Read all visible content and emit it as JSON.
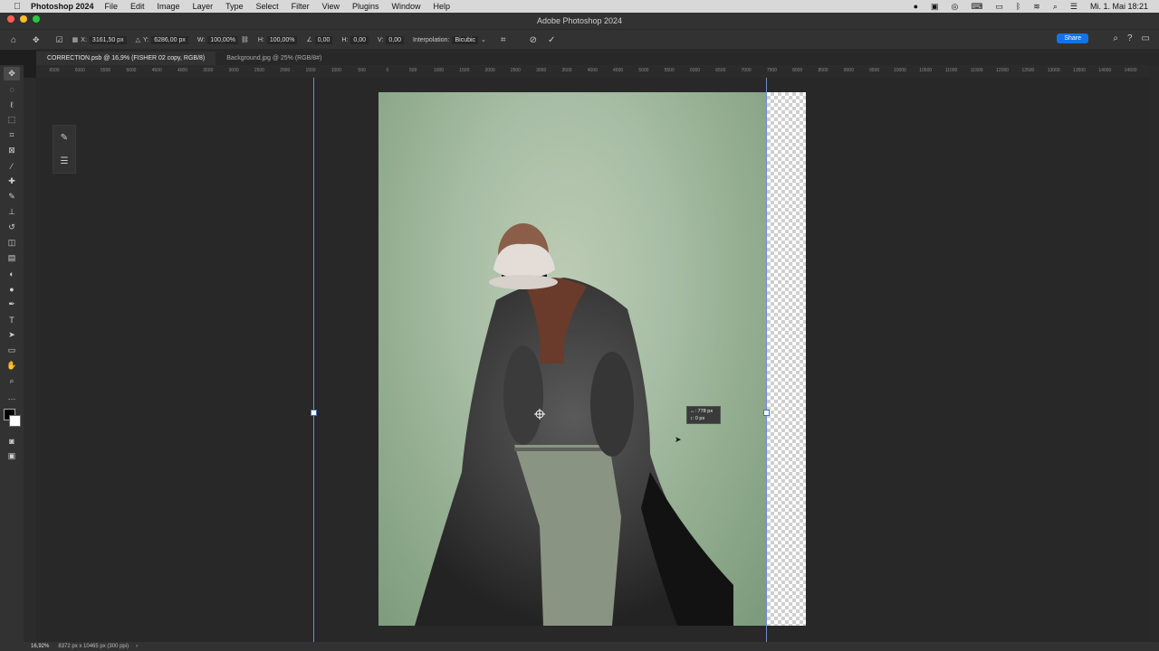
{
  "menubar": {
    "app_name": "Photoshop 2024",
    "items": [
      "File",
      "Edit",
      "Image",
      "Layer",
      "Type",
      "Select",
      "Filter",
      "View",
      "Plugins",
      "Window",
      "Help"
    ],
    "clock": "Mi. 1. Mai 18:21"
  },
  "window": {
    "title": "Adobe Photoshop 2024"
  },
  "options": {
    "x_label": "X:",
    "x_value": "3161,50 px",
    "y_label": "Y:",
    "y_value": "6286,00 px",
    "w_label": "W:",
    "w_value": "100,00%",
    "h_label": "H:",
    "h_value": "100,00%",
    "angle_value": "0,00",
    "hskew_label": "H:",
    "hskew_value": "0,00",
    "vskew_label": "V:",
    "vskew_value": "0,00",
    "interp_label": "Interpolation:",
    "interp_value": "Bicubic",
    "share_label": "Share"
  },
  "tabs": [
    {
      "label": "CORRECTION.psb @ 16,9% (FISHER 02 copy, RGB/8)"
    },
    {
      "label": "Background.jpg @ 25% (RGB/8#)"
    }
  ],
  "ruler_ticks": [
    "6500",
    "6000",
    "5500",
    "5000",
    "4500",
    "4000",
    "3500",
    "3000",
    "2500",
    "2000",
    "1500",
    "1000",
    "500",
    "0",
    "500",
    "1000",
    "1500",
    "2000",
    "2500",
    "3000",
    "3500",
    "4000",
    "4500",
    "5000",
    "5500",
    "6000",
    "6500",
    "7000",
    "7500",
    "8000",
    "8500",
    "9000",
    "9500",
    "10000",
    "10500",
    "11000",
    "11500",
    "12000",
    "12500",
    "13000",
    "13500",
    "14000",
    "14500"
  ],
  "hud": {
    "line1": "↔: 778 px",
    "line2": "↕: 0 px"
  },
  "status": {
    "zoom": "16,92%",
    "doc_info": "8372 px x 10465 px (300 ppi)"
  }
}
